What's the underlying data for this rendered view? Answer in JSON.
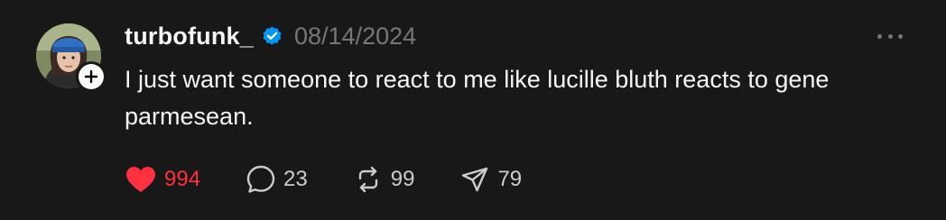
{
  "post": {
    "username": "turbofunk_",
    "timestamp": "08/14/2024",
    "text": "I just want someone to react to me like lucille bluth reacts to gene parmesean.",
    "verified": true
  },
  "actions": {
    "like_count": "994",
    "reply_count": "23",
    "repost_count": "99",
    "share_count": "79"
  },
  "icons": {
    "like": "heart-filled-icon",
    "reply": "speech-bubble-icon",
    "repost": "repost-icon",
    "share": "paper-plane-icon",
    "more": "more-horizontal-icon",
    "verified": "verified-badge-icon",
    "follow": "plus-icon"
  },
  "colors": {
    "background": "#181818",
    "text_primary": "#f3f5f7",
    "text_secondary": "#777777",
    "like_active": "#ff3040",
    "verified_blue": "#0095f6"
  }
}
